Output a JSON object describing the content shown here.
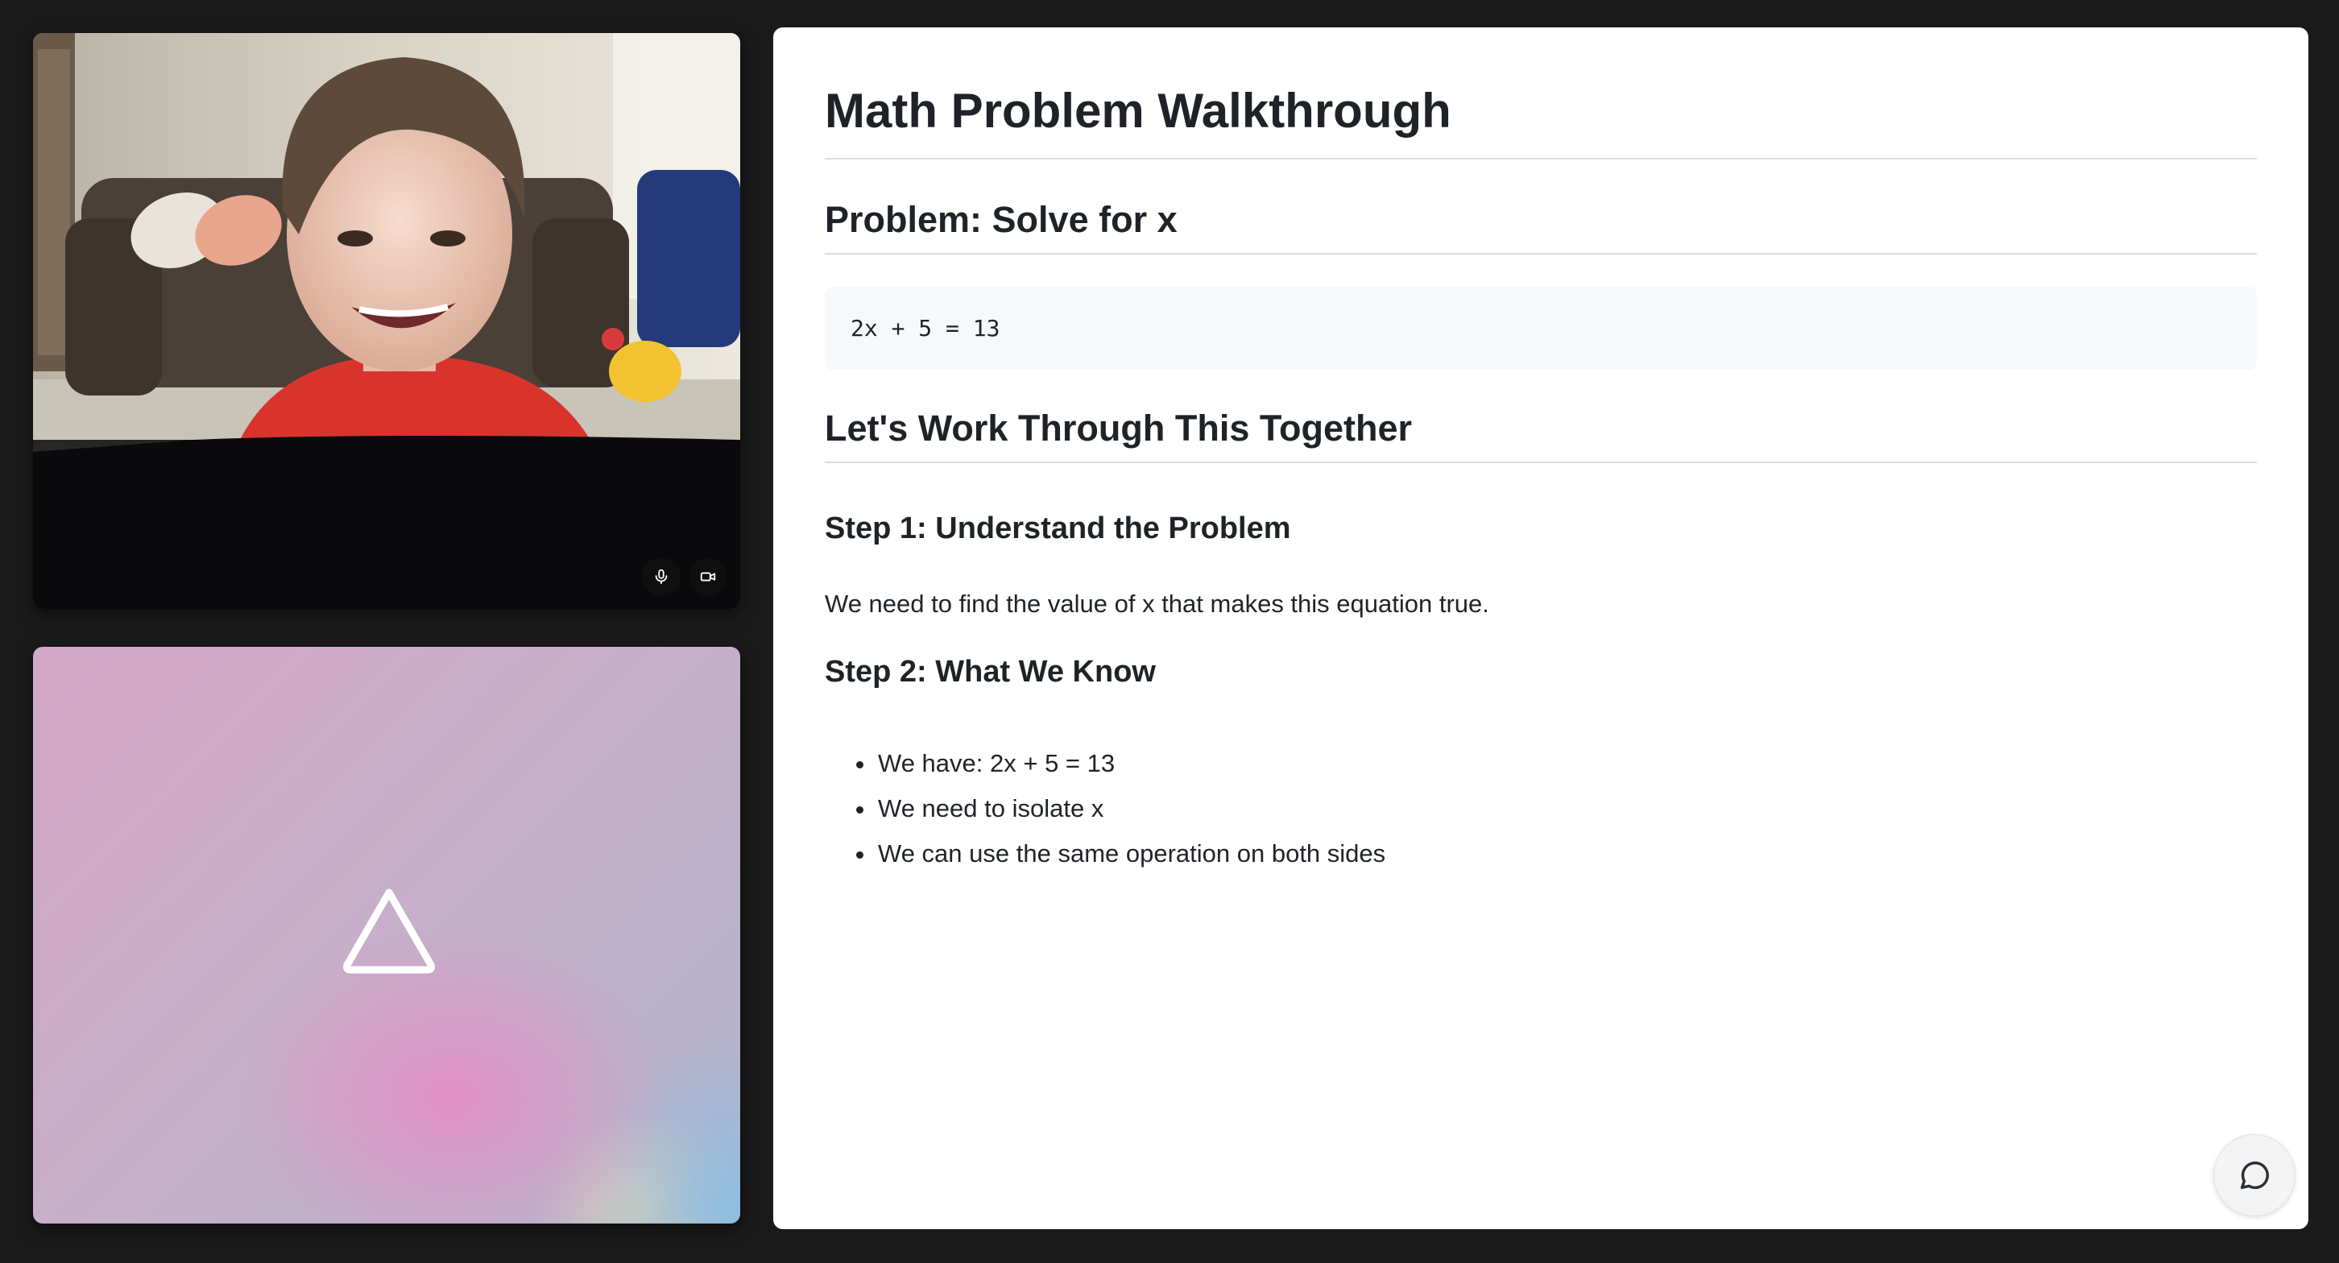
{
  "video": {
    "user_tile": {
      "mic_icon": "microphone-icon",
      "camera_icon": "video-camera-icon"
    },
    "ai_tile": {
      "icon": "triangle-icon"
    }
  },
  "document": {
    "title": "Math Problem Walkthrough",
    "problem_heading": "Problem: Solve for x",
    "equation": "2x + 5 = 13",
    "section_heading": "Let's Work Through This Together",
    "step1": {
      "heading": "Step 1: Understand the Problem",
      "text": "We need to find the value of x that makes this equation true."
    },
    "step2": {
      "heading": "Step 2: What We Know",
      "items": [
        "We have: 2x + 5 = 13",
        "We need to isolate x",
        "We can use the same operation on both sides"
      ]
    }
  },
  "chat_button": {
    "icon": "chat-bubble-icon"
  },
  "colors": {
    "background": "#1a1a1a",
    "panel": "#ffffff",
    "text": "#1f2328",
    "code_bg": "#f6f8fa",
    "divider": "#d8dee4"
  }
}
